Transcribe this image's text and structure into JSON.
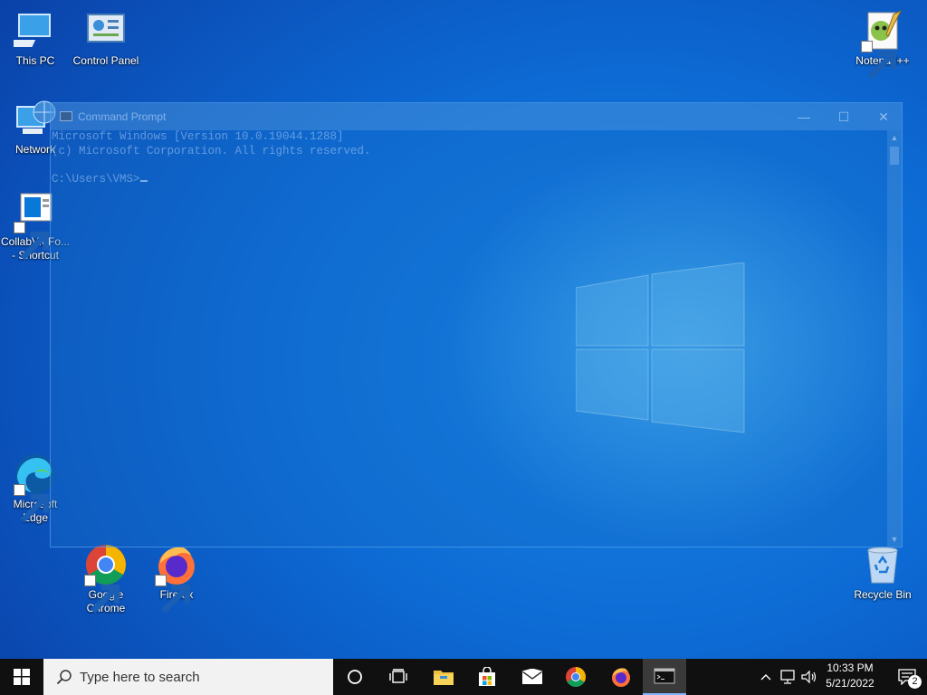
{
  "desktop": {
    "icons": {
      "this_pc": "This PC",
      "control_panel": "Control Panel",
      "notepad_pp": "Notepad++",
      "network": "Network",
      "collab_line1": "CollabVMFo...",
      "collab_line2": "- Shortcut",
      "edge_line1": "Microsoft",
      "edge_line2": "Edge",
      "chrome_line1": "Google",
      "chrome_line2": "Chrome",
      "firefox": "Firefox",
      "recycle_bin": "Recycle Bin"
    }
  },
  "cmd_window": {
    "title": "Command Prompt",
    "lines": [
      "Microsoft Windows [Version 10.0.19044.1288]",
      "(c) Microsoft Corporation. All rights reserved.",
      "",
      "C:\\Users\\VMS>"
    ],
    "minimize_glyph": "—",
    "maximize_glyph": "☐",
    "close_glyph": "✕"
  },
  "taskbar": {
    "search_placeholder": "Type here to search",
    "apps": [
      "Cortana",
      "Task View",
      "File Explorer",
      "Microsoft Store",
      "Mail",
      "Google Chrome",
      "Firefox",
      "Command Prompt"
    ],
    "clock_time": "10:33 PM",
    "clock_date": "5/21/2022",
    "notification_count": "2"
  },
  "colors": {
    "taskbar": "#101010",
    "desktop_accent": "#0a6fd6"
  }
}
